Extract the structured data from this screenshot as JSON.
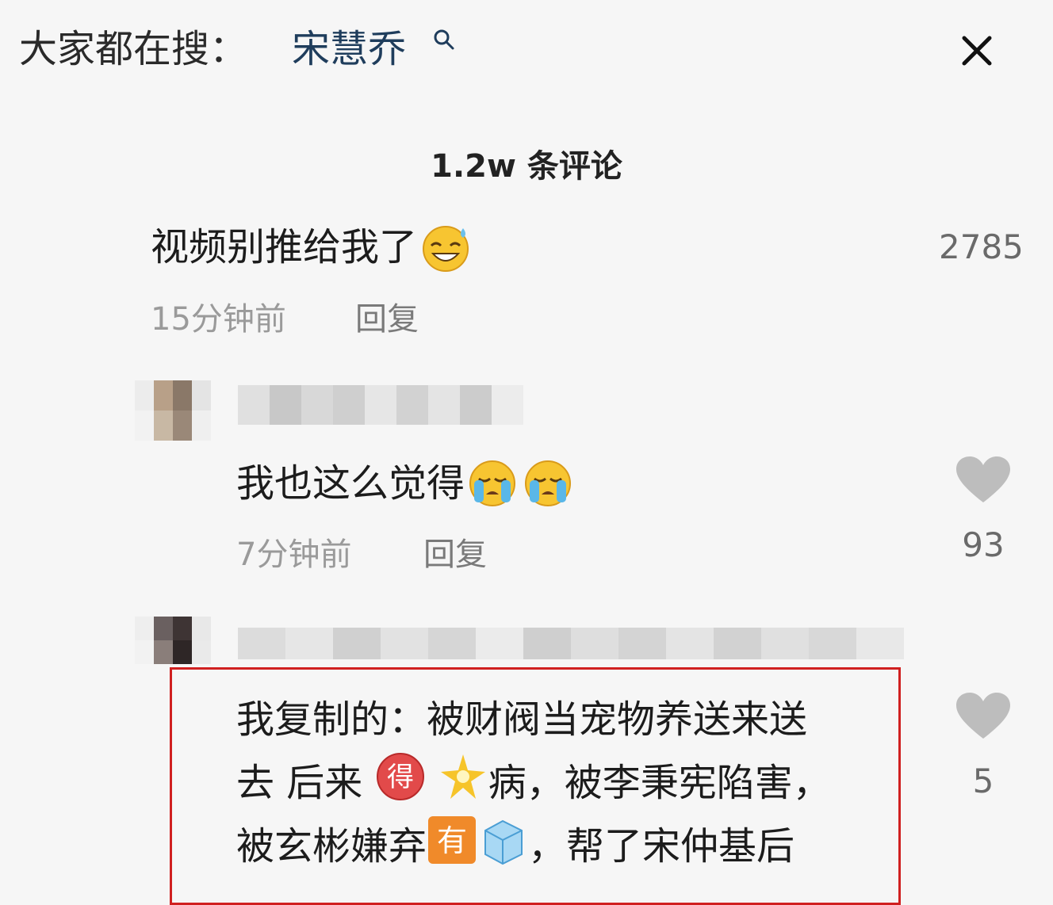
{
  "search_bar": {
    "prefix": "大家都在搜：",
    "term": "宋慧乔"
  },
  "comments_header": {
    "count_label": "1.2w 条评论"
  },
  "comments": [
    {
      "text": "视频别推给我了",
      "emoji": "laughing-sweat-emoji",
      "time": "15分钟前",
      "reply_label": "回复",
      "like_count": "2785"
    },
    {
      "username_redacted": true,
      "text": "我也这么觉得",
      "emoji": [
        "loudly-crying-emoji",
        "loudly-crying-emoji"
      ],
      "time": "7分钟前",
      "reply_label": "回复",
      "like_count": "93"
    },
    {
      "username_redacted": true,
      "lines": [
        "我复制的：被财阀当宠物养送来送",
        "去 后来",
        "病，被李秉宪陷害，",
        "被玄彬嫌弃",
        "，帮了宋仲基后"
      ],
      "badges": [
        "得",
        "有"
      ],
      "like_count": "5"
    }
  ],
  "colors": {
    "background": "#f6f6f6",
    "search_term": "#1f3d5c",
    "highlight_border": "#d02020",
    "meta_text": "#9a9a9a"
  }
}
